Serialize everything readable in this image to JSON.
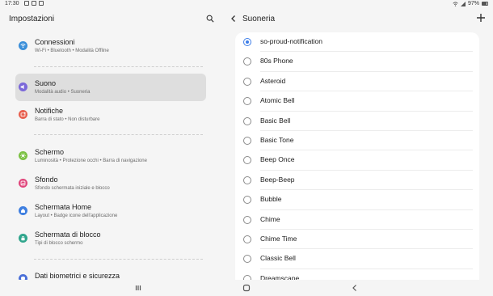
{
  "status_bar": {
    "time": "17:30",
    "battery": "97%"
  },
  "left_pane": {
    "title": "Impostazioni",
    "items": [
      {
        "title": "Connessioni",
        "subtitle": "Wi-Fi • Bluetooth • Modalità Offline",
        "icon": "wifi-icon",
        "color": "#3b8fd9",
        "selected": false
      },
      {
        "title": "Suono",
        "subtitle": "Modalità audio • Suoneria",
        "icon": "speaker-icon",
        "color": "#7b68d9",
        "selected": true
      },
      {
        "title": "Notifiche",
        "subtitle": "Barra di stato • Non disturbare",
        "icon": "notification-icon",
        "color": "#e8604f",
        "selected": false
      },
      {
        "title": "Schermo",
        "subtitle": "Luminosità • Protezione occhi • Barra di navigazione",
        "icon": "brightness-icon",
        "color": "#7cc144",
        "selected": false
      },
      {
        "title": "Sfondo",
        "subtitle": "Sfondo schermata iniziale e blocco",
        "icon": "wallpaper-icon",
        "color": "#e0457b",
        "selected": false
      },
      {
        "title": "Schermata Home",
        "subtitle": "Layout • Badge icone dell'applicazione",
        "icon": "home-icon",
        "color": "#3f7fe0",
        "selected": false
      },
      {
        "title": "Schermata di blocco",
        "subtitle": "Tipi di blocco schermo",
        "icon": "lock-icon",
        "color": "#2fa58c",
        "selected": false
      },
      {
        "title": "Dati biometrici e sicurezza",
        "subtitle": "",
        "icon": "shield-icon",
        "color": "#4a6fd8",
        "selected": false
      }
    ]
  },
  "right_pane": {
    "title": "Suoneria",
    "selected_index": 0,
    "ringtones": [
      "so-proud-notification",
      "80s Phone",
      "Asteroid",
      "Atomic Bell",
      "Basic Bell",
      "Basic Tone",
      "Beep Once",
      "Beep-Beep",
      "Bubble",
      "Chime",
      "Chime Time",
      "Classic Bell",
      "Dreamscape"
    ]
  },
  "colors": {
    "accent": "#3e7ee8",
    "selected_bg": "#dedede",
    "background": "#f5f5f5"
  }
}
